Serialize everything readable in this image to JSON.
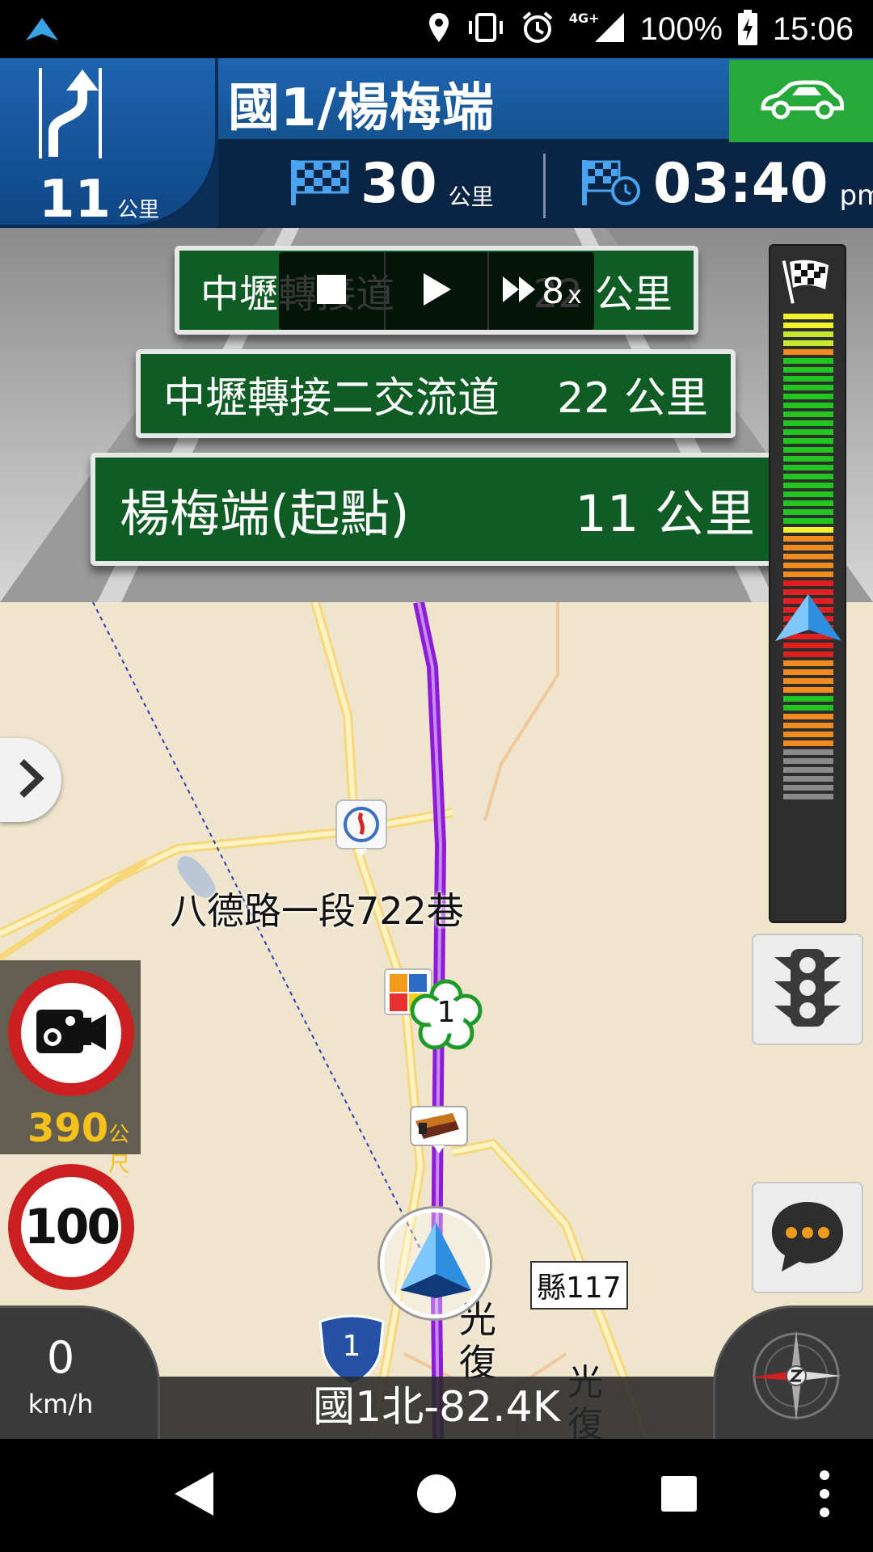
{
  "status_bar": {
    "network": "4G+",
    "battery": "100%",
    "time": "15:06"
  },
  "guidance": {
    "turn_distance": "11",
    "turn_distance_unit": "公里",
    "road_name": "國1/楊梅端",
    "remaining_distance": "30",
    "remaining_distance_unit": "公里",
    "eta_time": "03:40",
    "eta_suffix": "pm"
  },
  "signs": [
    {
      "name": "中壢轉接道",
      "distance": "22 公里"
    },
    {
      "name": "中壢轉接二交流道",
      "distance": "22 公里"
    },
    {
      "name": "楊梅端(起點)",
      "distance": "11 公里"
    }
  ],
  "playback": {
    "speed": "8",
    "speed_suffix": "x"
  },
  "map": {
    "street_label": "八德路一段722巷",
    "poi_number": "1",
    "county_road": "縣117",
    "highway_shield": "1",
    "place_label_1": "光復",
    "place_label_2": "光復"
  },
  "camera": {
    "distance": "390",
    "distance_unit": "公尺"
  },
  "speed_limit": "100",
  "speedometer": {
    "value": "0",
    "unit": "km/h"
  },
  "current_road": "國1北-82.4K",
  "traffic_bar": {
    "segments": [
      "#f2f230",
      "#f2f230",
      "#c6e832",
      "#c6e832",
      "#f28a1e",
      "#22c51f",
      "#22c51f",
      "#22c51f",
      "#22c51f",
      "#22c51f",
      "#22c51f",
      "#22c51f",
      "#22c51f",
      "#22c51f",
      "#22c51f",
      "#22c51f",
      "#22c51f",
      "#22c51f",
      "#22c51f",
      "#22c51f",
      "#22c51f",
      "#22c51f",
      "#22c51f",
      "#22c51f",
      "#f2f230",
      "#f28a1e",
      "#f28a1e",
      "#f28a1e",
      "#f28a1e",
      "#f28a1e",
      "#e02020",
      "#e02020",
      "#e02020",
      "#e02020",
      "#e02020",
      "#e02020",
      "#e02020",
      "#e02020",
      "#e02020",
      "#f28a1e",
      "#f28a1e",
      "#f28a1e",
      "#f28a1e",
      "#22c51f",
      "#22c51f",
      "#f28a1e",
      "#f28a1e",
      "#f28a1e",
      "#f28a1e",
      "#8a8a8a",
      "#8a8a8a",
      "#8a8a8a",
      "#8a8a8a",
      "#8a8a8a",
      "#8a8a8a"
    ],
    "position_fraction": 0.62
  },
  "colors": {
    "route": "#8e1bd6",
    "sign_green": "#0f5c25",
    "camera_text": "#f5c21b",
    "header_blue": "#1f65b3"
  }
}
